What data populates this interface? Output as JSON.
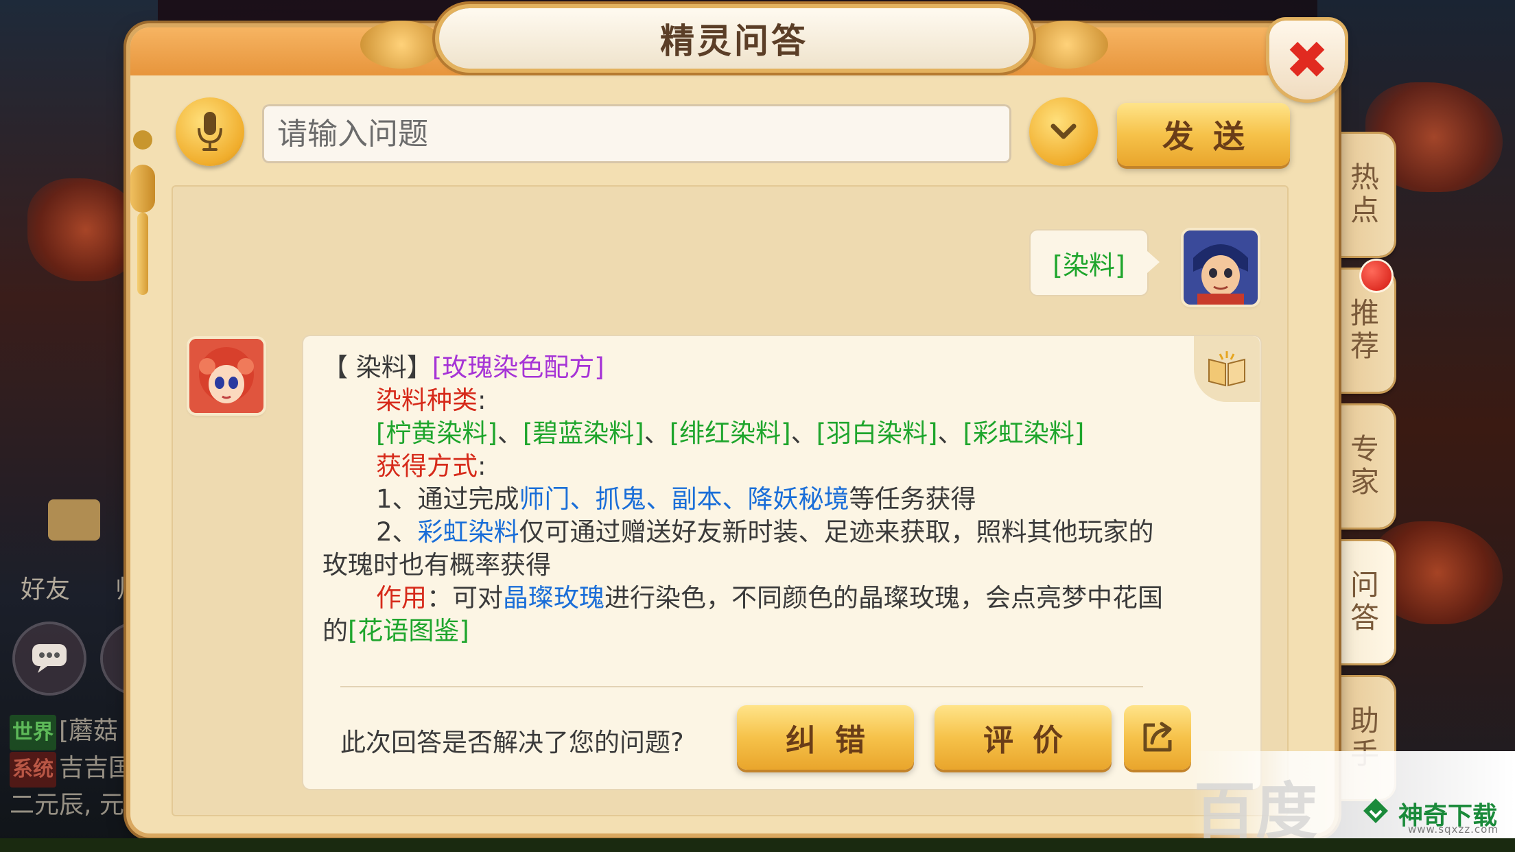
{
  "window": {
    "title": "精灵问答",
    "close_icon": "close-x-icon"
  },
  "input_bar": {
    "mic_icon": "microphone-icon",
    "placeholder": "请输入问题",
    "dropdown_icon": "chevron-down-icon",
    "send_label": "发送"
  },
  "conversation": {
    "user_query": "[染料]",
    "answer": {
      "title_prefix": "【 染料】",
      "title_link": "[玫瑰染色配方]",
      "types_heading": "染料种类",
      "colon": ":",
      "dye_types": [
        "[柠黄染料]",
        "[碧蓝染料]",
        "[绯红染料]",
        "[羽白染料]",
        "[彩虹染料]"
      ],
      "separator": "、",
      "obtain_heading": "获得方式",
      "method1_prefix": "1、通过完成",
      "method1_links": [
        "师门",
        "抓鬼",
        "副本",
        "降妖秘境"
      ],
      "method1_suffix": "等任务获得",
      "method2_prefix": "2、",
      "method2_link": "彩虹染料",
      "method2_text": "仅可通过赠送好友新时装、足迹来获取，照料其他玩家的",
      "method2_cont": "玫瑰时也有概率获得",
      "effect_heading": "作用",
      "effect_colon": "：",
      "effect_prefix": "可对",
      "effect_link": "晶璨玫瑰",
      "effect_text": "进行染色，不同颜色的晶璨玫瑰，会点亮梦中花国",
      "effect_cont_prefix": "的",
      "effect_cont_link": "[花语图鉴]"
    },
    "feedback_question": "此次回答是否解决了您的问题?",
    "fix_label": "纠错",
    "rate_label": "评价",
    "share_icon": "share-icon"
  },
  "side_tabs": [
    {
      "label": "热点"
    },
    {
      "label": "推荐"
    },
    {
      "label": "专家"
    },
    {
      "label": "问答"
    },
    {
      "label": "助手"
    }
  ],
  "hud": {
    "friends_label": "好友",
    "master_label": "师",
    "chat_lines": [
      {
        "tag": "世界",
        "text": "[蘑菇"
      },
      {
        "tag": "系统",
        "text": "吉吉国"
      },
      {
        "tag": "",
        "text": "二元辰, 元"
      }
    ]
  },
  "watermark": {
    "baidu": "百度",
    "brand": "神奇下载",
    "url": "www.sqxzz.com"
  },
  "colors": {
    "panel_bg": "#f3dfb2",
    "gold_button": "#f6c24a",
    "green_link": "#1ea52c",
    "red_heading": "#d62a1a",
    "blue_link": "#1a6ed8",
    "purple_link": "#a634d6",
    "close_red": "#e12a20"
  }
}
